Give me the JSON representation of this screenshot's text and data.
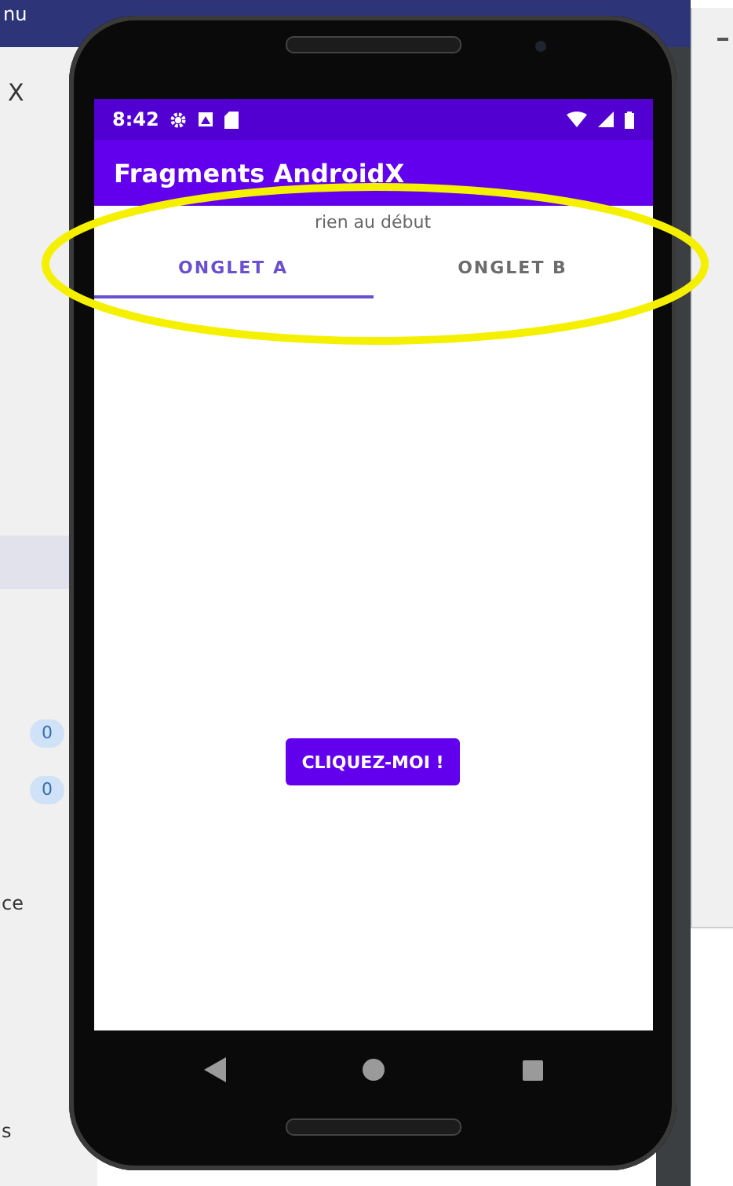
{
  "ide": {
    "menu_fragment": "nu",
    "title_fragment": "X",
    "counters": [
      "0",
      "0"
    ],
    "label_fragments": [
      "ce",
      "s"
    ]
  },
  "phone": {
    "status_bar": {
      "time": "8:42"
    },
    "app_bar": {
      "title": "Fragments AndroidX"
    },
    "message": "rien au début",
    "tabs": [
      {
        "label": "ONGLET A",
        "selected": true
      },
      {
        "label": "ONGLET B",
        "selected": false
      }
    ],
    "button": "CLIQUEZ-MOI !"
  },
  "annotation": {
    "kind": "ellipse"
  }
}
